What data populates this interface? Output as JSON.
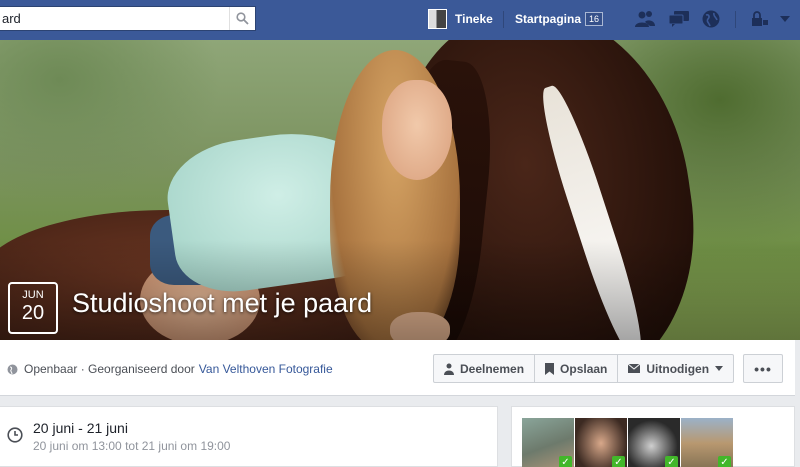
{
  "topbar": {
    "search_value": "ard",
    "profile_name": "Tineke",
    "home_label": "Startpagina",
    "home_count": "16",
    "icons": [
      "friend-requests-icon",
      "messages-icon",
      "notifications-globe-icon",
      "privacy-lock-icon",
      "account-menu-arrow-icon"
    ]
  },
  "event": {
    "month": "JUN",
    "day": "20",
    "title": "Studioshoot met je paard"
  },
  "meta": {
    "privacy": "Openbaar · Georganiseerd door",
    "organizer": "Van Velthoven Fotografie"
  },
  "actions": {
    "join": "Deelnemen",
    "save": "Opslaan",
    "invite": "Uitnodigen",
    "more": "•••"
  },
  "details": {
    "date_range": "20 juni - 21 juni",
    "time_range": "20 juni om 13:00 tot 21 juni om 19:00"
  },
  "attendees": {
    "count_shown": 4,
    "check_glyph": "✓"
  },
  "colors": {
    "topbar": "#3b5998",
    "link": "#365899",
    "going": "#42b72a"
  }
}
